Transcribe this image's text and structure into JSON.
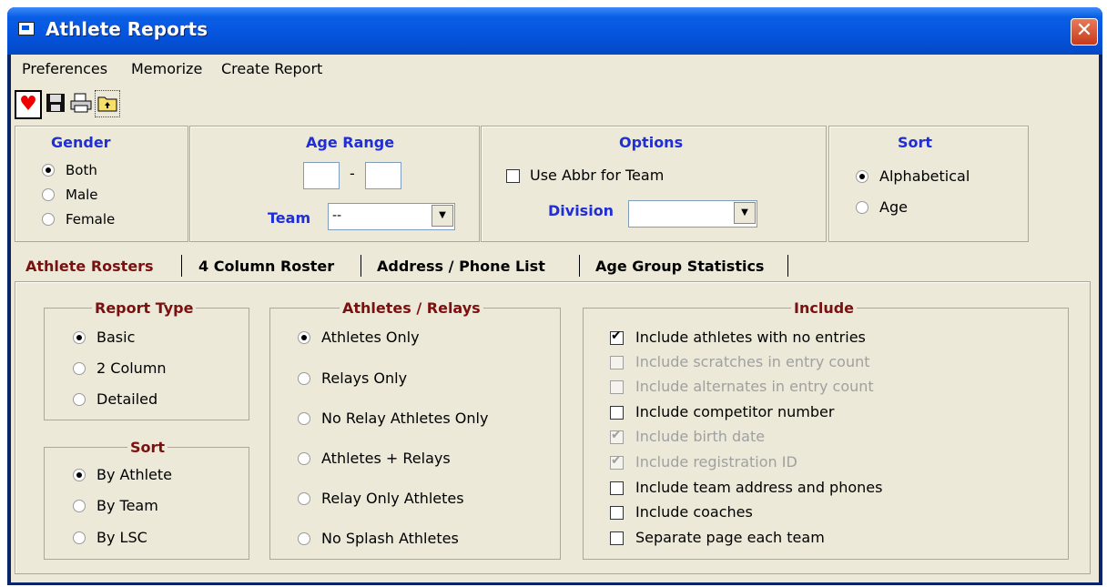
{
  "window": {
    "title": "Athlete Reports",
    "close_symbol": "✕"
  },
  "menu": [
    "Preferences",
    "Memorize",
    "Create Report"
  ],
  "toolbar": {
    "heart_symbol": "♥",
    "floppy_symbol": "💾",
    "printer_symbol": "🖶",
    "folder_symbol": "⬆"
  },
  "gender": {
    "title": "Gender",
    "options": [
      "Both",
      "Male",
      "Female"
    ],
    "selected": "Both"
  },
  "age_range": {
    "title": "Age Range",
    "min": "",
    "max": "",
    "separator": "-",
    "team_label": "Team",
    "team_value": "--"
  },
  "options": {
    "title": "Options",
    "use_abbr_label": "Use Abbr for Team",
    "use_abbr_checked": false,
    "division_label": "Division",
    "division_value": ""
  },
  "sort_top": {
    "title": "Sort",
    "options": [
      "Alphabetical",
      "Age"
    ],
    "selected": "Alphabetical"
  },
  "tabs": [
    "Athlete Rosters",
    "4 Column Roster",
    "Address / Phone List",
    "Age Group Statistics"
  ],
  "active_tab": "Athlete Rosters",
  "report_type": {
    "title": "Report Type",
    "options": [
      "Basic",
      "2 Column",
      "Detailed"
    ],
    "selected": "Basic"
  },
  "sort_bottom": {
    "title": "Sort",
    "options": [
      "By Athlete",
      "By Team",
      "By LSC"
    ],
    "selected": "By Athlete"
  },
  "athletes_relays": {
    "title": "Athletes / Relays",
    "options": [
      "Athletes Only",
      "Relays Only",
      "No Relay Athletes Only",
      "Athletes + Relays",
      "Relay Only Athletes",
      "No Splash Athletes"
    ],
    "selected": "Athletes Only"
  },
  "include": {
    "title": "Include",
    "items": [
      {
        "label": "Include athletes with no entries",
        "checked": true,
        "enabled": true
      },
      {
        "label": "Include scratches in entry count",
        "checked": false,
        "enabled": false
      },
      {
        "label": "Include alternates in entry count",
        "checked": false,
        "enabled": false
      },
      {
        "label": "Include competitor number",
        "checked": false,
        "enabled": true
      },
      {
        "label": "Include birth date",
        "checked": true,
        "enabled": false
      },
      {
        "label": "Include registration ID",
        "checked": true,
        "enabled": false
      },
      {
        "label": "Include team address and phones",
        "checked": false,
        "enabled": true
      },
      {
        "label": "Include coaches",
        "checked": false,
        "enabled": true
      },
      {
        "label": "Separate page each team",
        "checked": false,
        "enabled": true
      }
    ]
  },
  "colors": {
    "title_bar": "#0554dd",
    "header_blue": "#1f2ed6",
    "group_label_red": "#7a1010",
    "window_bg": "#ece9d8"
  }
}
